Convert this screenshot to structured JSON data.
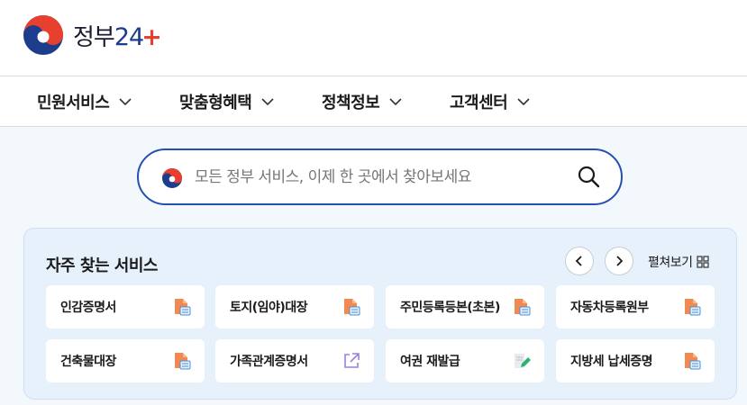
{
  "header": {
    "logo_text": "정부",
    "logo_number": "24",
    "logo_plus": "+"
  },
  "gnb": {
    "items": [
      "민원서비스",
      "맞춤형혜택",
      "정책정보",
      "고객센터"
    ]
  },
  "search": {
    "placeholder": "모든 정부 서비스, 이제 한 곳에서 찾아보세요"
  },
  "services": {
    "title": "자주 찾는 서비스",
    "expand_label": "펼쳐보기",
    "items": [
      {
        "label": "인감증명서",
        "icon": "pdf-document-icon"
      },
      {
        "label": "토지(임야)대장",
        "icon": "pdf-document-icon"
      },
      {
        "label": "주민등록등본(초본)",
        "icon": "pdf-document-icon"
      },
      {
        "label": "자동차등록원부",
        "icon": "pdf-document-icon"
      },
      {
        "label": "건축물대장",
        "icon": "pdf-document-icon"
      },
      {
        "label": "가족관계증명서",
        "icon": "external-link-icon"
      },
      {
        "label": "여권 재발급",
        "icon": "edit-form-icon"
      },
      {
        "label": "지방세 납세증명",
        "icon": "pdf-document-icon"
      }
    ]
  },
  "colors": {
    "brand_blue": "#2550b4",
    "brand_red": "#e8402e",
    "panel_bg": "#e6f1fc",
    "page_bg": "#f3f8fd"
  }
}
